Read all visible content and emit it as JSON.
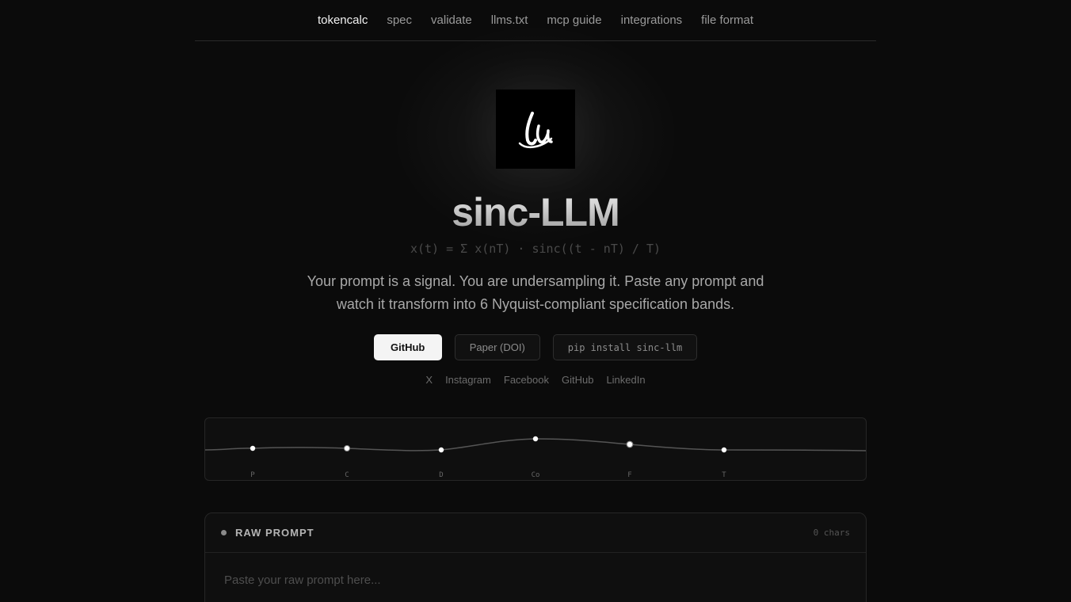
{
  "nav": {
    "items": [
      {
        "label": "tokencalc",
        "active": true
      },
      {
        "label": "spec",
        "active": false
      },
      {
        "label": "validate",
        "active": false
      },
      {
        "label": "llms.txt",
        "active": false
      },
      {
        "label": "mcp guide",
        "active": false
      },
      {
        "label": "integrations",
        "active": false
      },
      {
        "label": "file format",
        "active": false
      }
    ]
  },
  "hero": {
    "logo_icon": "ll-monogram-icon",
    "title": "sinc-LLM",
    "formula": "x(t) = Σ x(nT) · sinc((t - nT) / T)",
    "tagline": "Your prompt is a signal. You are undersampling it. Paste any prompt and watch it transform into 6 Nyquist-compliant specification bands."
  },
  "buttons": {
    "github": "GitHub",
    "paper": "Paper (DOI)",
    "pip": "pip install sinc-llm"
  },
  "social": [
    "X",
    "Instagram",
    "Facebook",
    "GitHub",
    "LinkedIn"
  ],
  "bands": {
    "labels": [
      "P",
      "C",
      "D",
      "Co",
      "F",
      "T"
    ]
  },
  "raw_prompt": {
    "title": "RAW PROMPT",
    "chars": "0 chars",
    "placeholder": "Paste your raw prompt here..."
  },
  "colors": {
    "background": "#0b0b0b",
    "primary_button": "#f4f4f4",
    "muted_text": "#9a9a9a"
  }
}
